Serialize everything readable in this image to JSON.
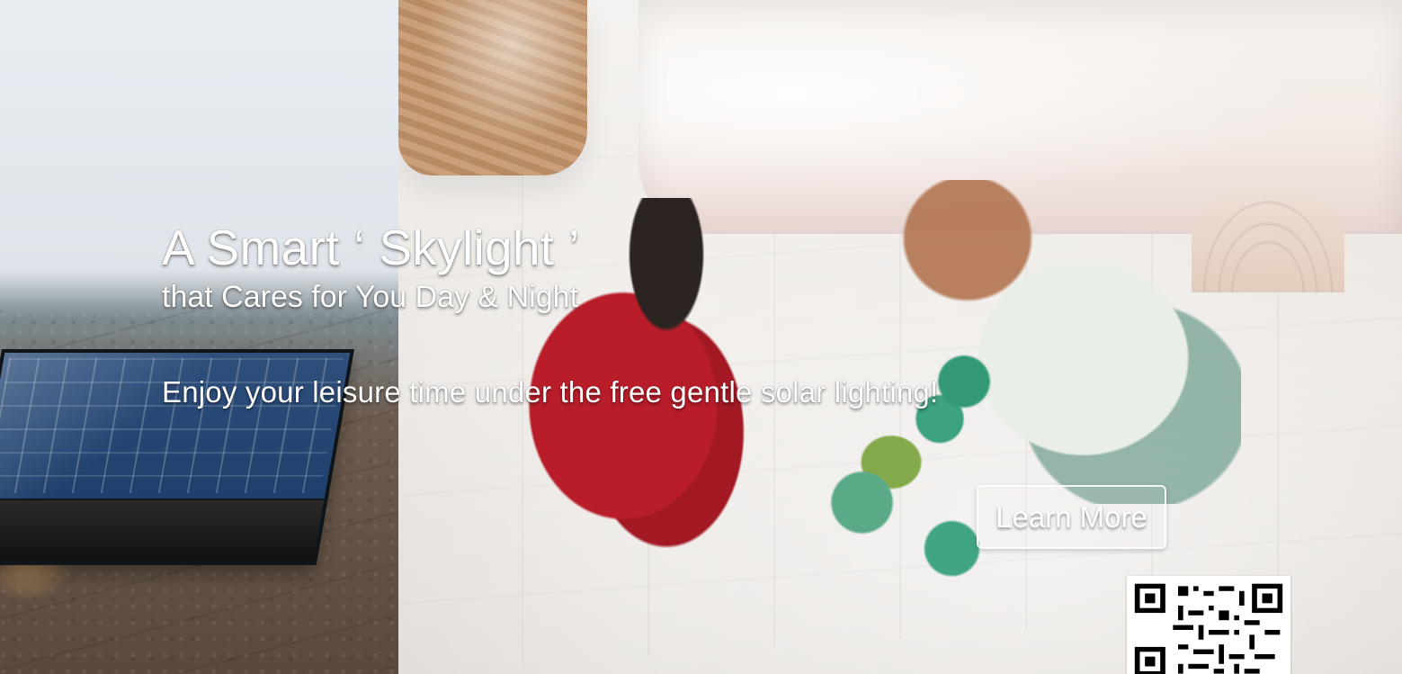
{
  "hero": {
    "headline": "A Smart ‘ Skylight ’",
    "subhead": "that Cares for You Day & Night",
    "tagline": "Enjoy your leisure time under the free gentle solar lighting!",
    "cta_label": "Learn More"
  },
  "colors": {
    "text": "#ffffff",
    "accent_red": "#b31f2b",
    "accent_green": "#2a9a73",
    "panel_blue": "#1e3f6c"
  },
  "icons": {
    "qr_code": "qr-code-icon"
  }
}
